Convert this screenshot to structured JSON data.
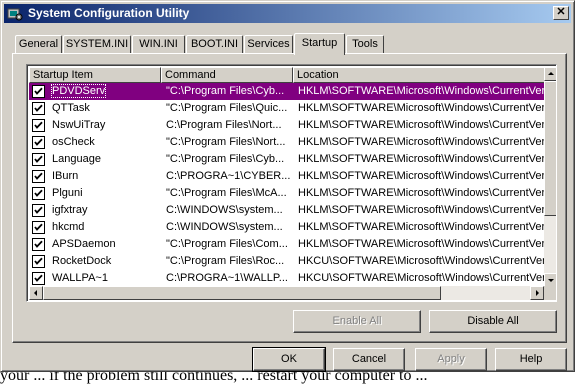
{
  "background_text": "your ... if the problem still continues, ... restart your computer to ...",
  "window": {
    "title": "System Configuration Utility",
    "close_glyph": "✕"
  },
  "tabs": [
    {
      "label": "General",
      "active": false
    },
    {
      "label": "SYSTEM.INI",
      "active": false
    },
    {
      "label": "WIN.INI",
      "active": false
    },
    {
      "label": "BOOT.INI",
      "active": false
    },
    {
      "label": "Services",
      "active": false
    },
    {
      "label": "Startup",
      "active": true
    },
    {
      "label": "Tools",
      "active": false
    }
  ],
  "startup": {
    "columns": {
      "item": "Startup Item",
      "command": "Command",
      "location": "Location"
    },
    "rows": [
      {
        "item": "PDVDServ",
        "command": "\"C:\\Program Files\\Cyb...",
        "location": "HKLM\\SOFTWARE\\Microsoft\\Windows\\CurrentVer...",
        "checked": true,
        "selected": true
      },
      {
        "item": "QTTask",
        "command": "\"C:\\Program Files\\Quic...",
        "location": "HKLM\\SOFTWARE\\Microsoft\\Windows\\CurrentVer...",
        "checked": true,
        "selected": false
      },
      {
        "item": "NswUiTray",
        "command": "C:\\Program Files\\Nort...",
        "location": "HKLM\\SOFTWARE\\Microsoft\\Windows\\CurrentVer...",
        "checked": true,
        "selected": false
      },
      {
        "item": "osCheck",
        "command": "\"C:\\Program Files\\Nort...",
        "location": "HKLM\\SOFTWARE\\Microsoft\\Windows\\CurrentVer...",
        "checked": true,
        "selected": false
      },
      {
        "item": "Language",
        "command": "\"C:\\Program Files\\Cyb...",
        "location": "HKLM\\SOFTWARE\\Microsoft\\Windows\\CurrentVer...",
        "checked": true,
        "selected": false
      },
      {
        "item": "IBurn",
        "command": "C:\\PROGRA~1\\CYBER...",
        "location": "HKLM\\SOFTWARE\\Microsoft\\Windows\\CurrentVer...",
        "checked": true,
        "selected": false
      },
      {
        "item": "Plguni",
        "command": "\"C:\\Program Files\\McA...",
        "location": "HKLM\\SOFTWARE\\Microsoft\\Windows\\CurrentVer...",
        "checked": true,
        "selected": false
      },
      {
        "item": "igfxtray",
        "command": "C:\\WINDOWS\\system...",
        "location": "HKLM\\SOFTWARE\\Microsoft\\Windows\\CurrentVer...",
        "checked": true,
        "selected": false
      },
      {
        "item": "hkcmd",
        "command": "C:\\WINDOWS\\system...",
        "location": "HKLM\\SOFTWARE\\Microsoft\\Windows\\CurrentVer...",
        "checked": true,
        "selected": false
      },
      {
        "item": "APSDaemon",
        "command": "\"C:\\Program Files\\Com...",
        "location": "HKLM\\SOFTWARE\\Microsoft\\Windows\\CurrentVer...",
        "checked": true,
        "selected": false
      },
      {
        "item": "RocketDock",
        "command": "\"C:\\Program Files\\Roc...",
        "location": "HKCU\\SOFTWARE\\Microsoft\\Windows\\CurrentVer...",
        "checked": true,
        "selected": false
      },
      {
        "item": "WALLPA~1",
        "command": "C:\\PROGRA~1\\WALLP...",
        "location": "HKCU\\SOFTWARE\\Microsoft\\Windows\\CurrentVer...",
        "checked": true,
        "selected": false
      }
    ],
    "enable_all_label": "Enable All",
    "disable_all_label": "Disable All"
  },
  "footer": {
    "ok_label": "OK",
    "cancel_label": "Cancel",
    "apply_label": "Apply",
    "help_label": "Help"
  },
  "colors": {
    "titlebar_start": "#0a246a",
    "titlebar_end": "#a6caf0",
    "selection": "#800080",
    "face": "#d4d0c8"
  }
}
